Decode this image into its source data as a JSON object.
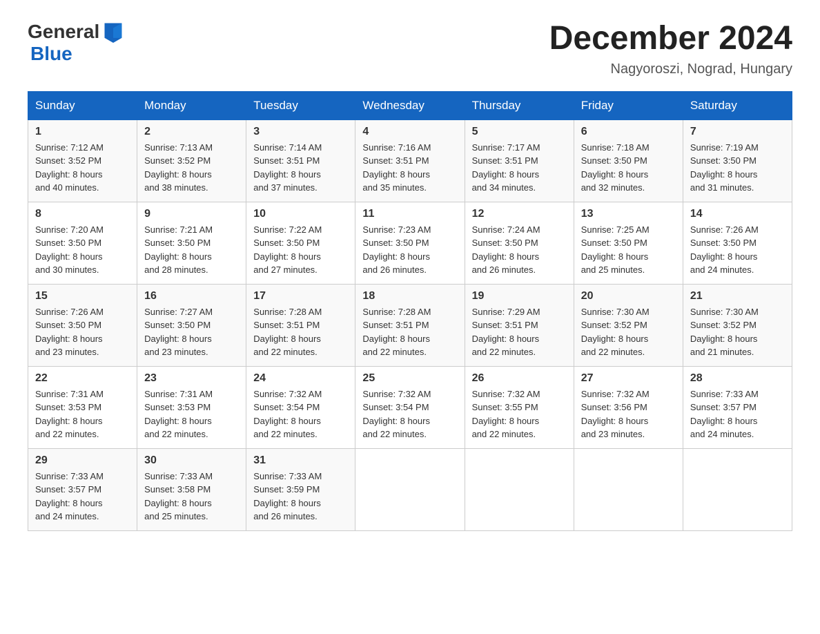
{
  "header": {
    "logo_general": "General",
    "logo_blue": "Blue",
    "month_title": "December 2024",
    "location": "Nagyoroszi, Nograd, Hungary"
  },
  "columns": [
    "Sunday",
    "Monday",
    "Tuesday",
    "Wednesday",
    "Thursday",
    "Friday",
    "Saturday"
  ],
  "weeks": [
    [
      {
        "day": "1",
        "sunrise": "7:12 AM",
        "sunset": "3:52 PM",
        "daylight": "8 hours and 40 minutes."
      },
      {
        "day": "2",
        "sunrise": "7:13 AM",
        "sunset": "3:52 PM",
        "daylight": "8 hours and 38 minutes."
      },
      {
        "day": "3",
        "sunrise": "7:14 AM",
        "sunset": "3:51 PM",
        "daylight": "8 hours and 37 minutes."
      },
      {
        "day": "4",
        "sunrise": "7:16 AM",
        "sunset": "3:51 PM",
        "daylight": "8 hours and 35 minutes."
      },
      {
        "day": "5",
        "sunrise": "7:17 AM",
        "sunset": "3:51 PM",
        "daylight": "8 hours and 34 minutes."
      },
      {
        "day": "6",
        "sunrise": "7:18 AM",
        "sunset": "3:50 PM",
        "daylight": "8 hours and 32 minutes."
      },
      {
        "day": "7",
        "sunrise": "7:19 AM",
        "sunset": "3:50 PM",
        "daylight": "8 hours and 31 minutes."
      }
    ],
    [
      {
        "day": "8",
        "sunrise": "7:20 AM",
        "sunset": "3:50 PM",
        "daylight": "8 hours and 30 minutes."
      },
      {
        "day": "9",
        "sunrise": "7:21 AM",
        "sunset": "3:50 PM",
        "daylight": "8 hours and 28 minutes."
      },
      {
        "day": "10",
        "sunrise": "7:22 AM",
        "sunset": "3:50 PM",
        "daylight": "8 hours and 27 minutes."
      },
      {
        "day": "11",
        "sunrise": "7:23 AM",
        "sunset": "3:50 PM",
        "daylight": "8 hours and 26 minutes."
      },
      {
        "day": "12",
        "sunrise": "7:24 AM",
        "sunset": "3:50 PM",
        "daylight": "8 hours and 26 minutes."
      },
      {
        "day": "13",
        "sunrise": "7:25 AM",
        "sunset": "3:50 PM",
        "daylight": "8 hours and 25 minutes."
      },
      {
        "day": "14",
        "sunrise": "7:26 AM",
        "sunset": "3:50 PM",
        "daylight": "8 hours and 24 minutes."
      }
    ],
    [
      {
        "day": "15",
        "sunrise": "7:26 AM",
        "sunset": "3:50 PM",
        "daylight": "8 hours and 23 minutes."
      },
      {
        "day": "16",
        "sunrise": "7:27 AM",
        "sunset": "3:50 PM",
        "daylight": "8 hours and 23 minutes."
      },
      {
        "day": "17",
        "sunrise": "7:28 AM",
        "sunset": "3:51 PM",
        "daylight": "8 hours and 22 minutes."
      },
      {
        "day": "18",
        "sunrise": "7:28 AM",
        "sunset": "3:51 PM",
        "daylight": "8 hours and 22 minutes."
      },
      {
        "day": "19",
        "sunrise": "7:29 AM",
        "sunset": "3:51 PM",
        "daylight": "8 hours and 22 minutes."
      },
      {
        "day": "20",
        "sunrise": "7:30 AM",
        "sunset": "3:52 PM",
        "daylight": "8 hours and 22 minutes."
      },
      {
        "day": "21",
        "sunrise": "7:30 AM",
        "sunset": "3:52 PM",
        "daylight": "8 hours and 21 minutes."
      }
    ],
    [
      {
        "day": "22",
        "sunrise": "7:31 AM",
        "sunset": "3:53 PM",
        "daylight": "8 hours and 22 minutes."
      },
      {
        "day": "23",
        "sunrise": "7:31 AM",
        "sunset": "3:53 PM",
        "daylight": "8 hours and 22 minutes."
      },
      {
        "day": "24",
        "sunrise": "7:32 AM",
        "sunset": "3:54 PM",
        "daylight": "8 hours and 22 minutes."
      },
      {
        "day": "25",
        "sunrise": "7:32 AM",
        "sunset": "3:54 PM",
        "daylight": "8 hours and 22 minutes."
      },
      {
        "day": "26",
        "sunrise": "7:32 AM",
        "sunset": "3:55 PM",
        "daylight": "8 hours and 22 minutes."
      },
      {
        "day": "27",
        "sunrise": "7:32 AM",
        "sunset": "3:56 PM",
        "daylight": "8 hours and 23 minutes."
      },
      {
        "day": "28",
        "sunrise": "7:33 AM",
        "sunset": "3:57 PM",
        "daylight": "8 hours and 24 minutes."
      }
    ],
    [
      {
        "day": "29",
        "sunrise": "7:33 AM",
        "sunset": "3:57 PM",
        "daylight": "8 hours and 24 minutes."
      },
      {
        "day": "30",
        "sunrise": "7:33 AM",
        "sunset": "3:58 PM",
        "daylight": "8 hours and 25 minutes."
      },
      {
        "day": "31",
        "sunrise": "7:33 AM",
        "sunset": "3:59 PM",
        "daylight": "8 hours and 26 minutes."
      },
      null,
      null,
      null,
      null
    ]
  ],
  "labels": {
    "sunrise_prefix": "Sunrise: ",
    "sunset_prefix": "Sunset: ",
    "daylight_prefix": "Daylight: "
  }
}
